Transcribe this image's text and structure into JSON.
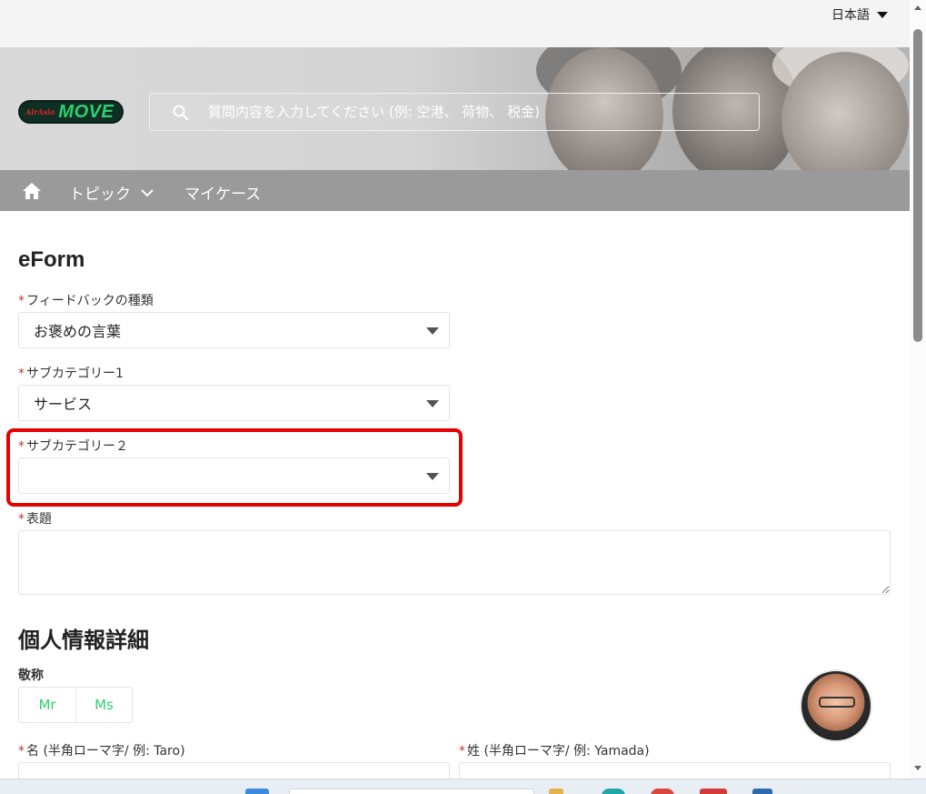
{
  "header": {
    "language": "日本語",
    "search_placeholder": "質問内容を入力してください (例: 空港、 荷物、 税金)",
    "logo_small": "AirAsia",
    "logo_text": "MOVE"
  },
  "nav": {
    "home_icon": "home-icon",
    "topics": "トピック",
    "my_cases": "マイケース"
  },
  "form": {
    "title": "eForm",
    "required_mark": "*",
    "feedback_type": {
      "label": "フィードバックの種類",
      "value": "お褒めの言葉"
    },
    "subcategory1": {
      "label": "サブカテゴリー1",
      "value": "サービス"
    },
    "subcategory2": {
      "label": "サブカテゴリー２",
      "value": ""
    },
    "subject": {
      "label": "表題",
      "value": ""
    }
  },
  "personal": {
    "title": "個人情報詳細",
    "salutation_label": "敬称",
    "salutation_options": [
      "Mr",
      "Ms"
    ],
    "first_name_label": "名 (半角ローマ字/ 例: Taro)",
    "last_name_label": "姓 (半角ローマ字/ 例: Yamada)"
  },
  "colors": {
    "accent_green": "#2fd06f",
    "required_red": "#c23934",
    "highlight_red": "#e60000",
    "nav_gray": "#9a9a9a"
  }
}
